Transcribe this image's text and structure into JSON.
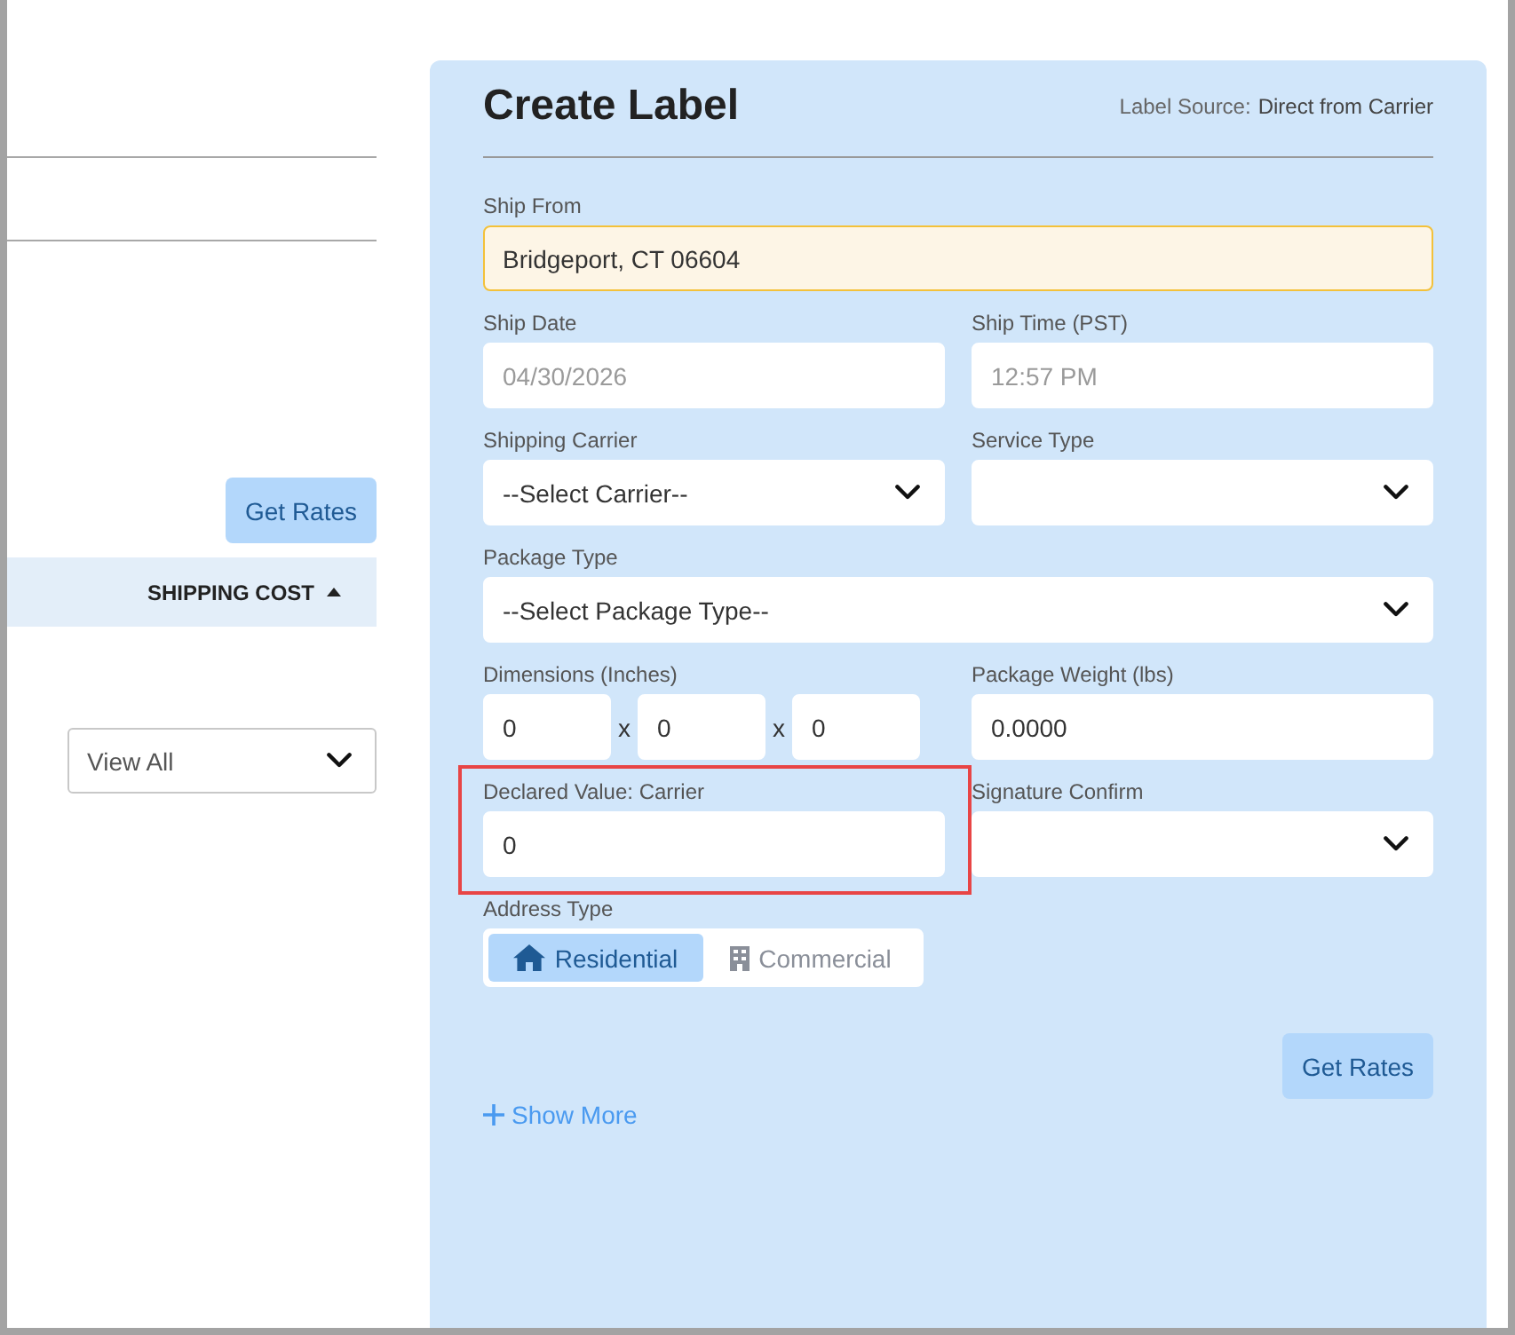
{
  "left_pane": {
    "get_rates_button": "Get Rates",
    "sort_header": {
      "label": "SHIPPING COST",
      "ascending": true
    },
    "filter_select": {
      "value": "View All"
    }
  },
  "create_label": {
    "title": "Create Label",
    "source": {
      "label": "Label Source:",
      "value": "Direct from Carrier"
    },
    "rows": [
      {
        "fields": [
          {
            "kind": "text",
            "label": "Ship From",
            "value": "Bridgeport, CT 06604",
            "disabled": false,
            "autofilled": true,
            "highlighted": false
          }
        ]
      },
      {
        "fields": [
          {
            "kind": "text",
            "label": "Ship Date",
            "value": "04/30/2026",
            "disabled": true,
            "autofilled": false,
            "highlighted": false
          },
          {
            "kind": "text",
            "label": "Ship Time (PST)",
            "value": "12:57 PM",
            "disabled": true,
            "autofilled": false,
            "highlighted": false
          }
        ]
      },
      {
        "fields": [
          {
            "kind": "select",
            "label": "Shipping Carrier",
            "value": "--Select Carrier--",
            "disabled": false,
            "autofilled": false,
            "highlighted": false
          },
          {
            "kind": "select",
            "label": "Service Type",
            "disabled": false,
            "autofilled": false,
            "highlighted": false
          }
        ]
      },
      {
        "fields": [
          {
            "kind": "select",
            "label": "Package Type",
            "value": "--Select Package Type--",
            "disabled": false,
            "autofilled": false,
            "highlighted": false
          }
        ]
      },
      {
        "fields": [
          {
            "kind": "dimensions",
            "label": "Dimensions (Inches)",
            "values": [
              "0",
              "0",
              "0"
            ],
            "separators": [
              "x",
              "x"
            ],
            "disabled": false,
            "autofilled": false,
            "highlighted": false
          },
          {
            "kind": "text",
            "label": "Package Weight (lbs)",
            "value": "0.0000",
            "disabled": false,
            "autofilled": false,
            "highlighted": false
          }
        ]
      },
      {
        "fields": [
          {
            "kind": "text",
            "label": "Declared Value: Carrier",
            "value": "0",
            "disabled": false,
            "autofilled": false,
            "highlighted": true
          },
          {
            "kind": "select",
            "label": "Signature Confirm",
            "disabled": false,
            "autofilled": false,
            "highlighted": false
          }
        ]
      },
      {
        "fields": [
          {
            "kind": "toggle",
            "label": "Address Type",
            "options": [
              {
                "label": "Residential",
                "selected": true
              },
              {
                "label": "Commercial",
                "selected": false
              }
            ],
            "disabled": false,
            "autofilled": false,
            "highlighted": false
          }
        ]
      }
    ],
    "get_rates_button": "Get Rates",
    "show_more_link": "Show More"
  }
}
